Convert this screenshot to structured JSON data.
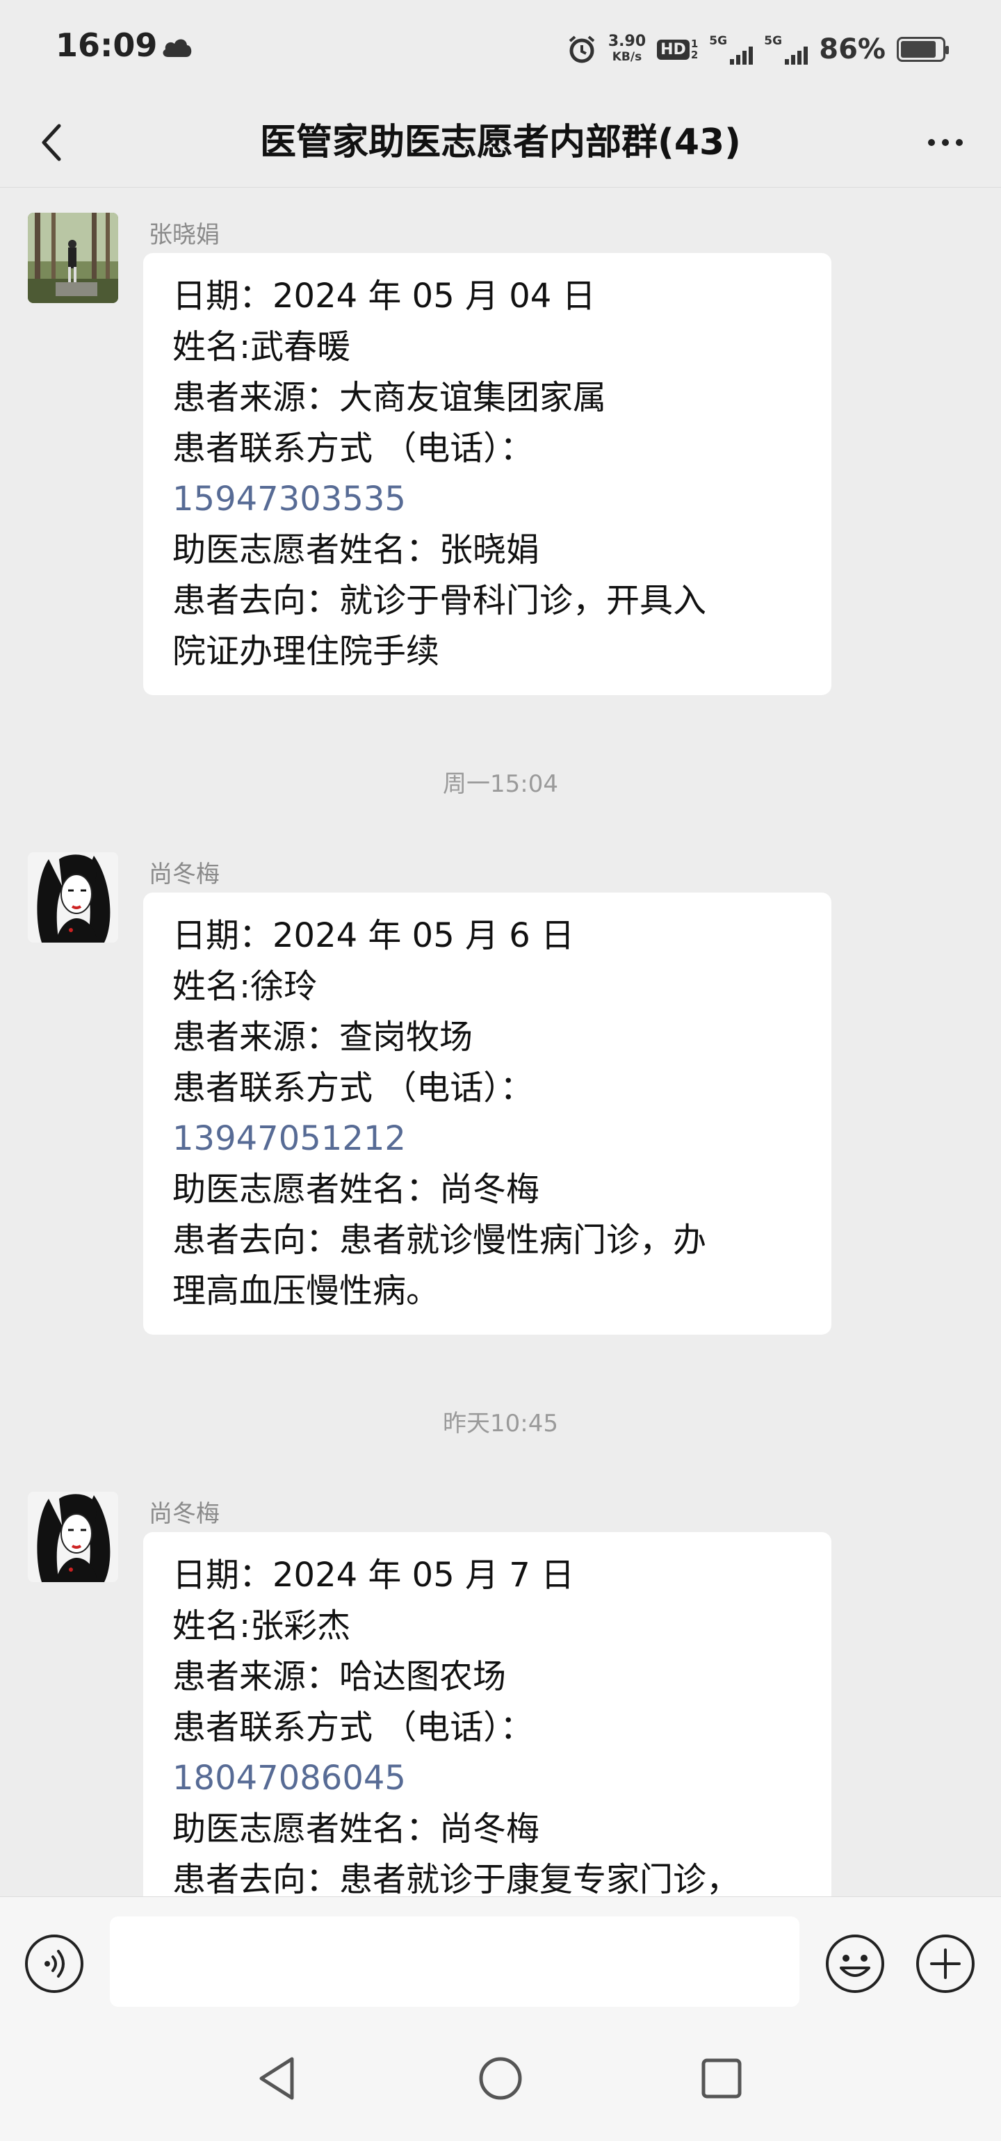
{
  "status_bar": {
    "time": "16:09",
    "net_speed_value": "3.90",
    "net_speed_unit": "KB/s",
    "hd_label": "HD",
    "hd_sub_top": "1",
    "hd_sub_bottom": "2",
    "signal1_label": "5G",
    "signal2_label": "5G",
    "battery_percent": "86%",
    "battery_level": 0.86
  },
  "header": {
    "title": "医管家助医志愿者内部群(43)"
  },
  "messages": [
    {
      "sender": "张晓娟",
      "lines": [
        "日期：2024 年 05 月 04 日",
        "姓名:武春暖",
        "患者来源：大商友谊集团家属",
        "患者联系方式 （电话）："
      ],
      "phone": "15947303535",
      "lines_after": [
        "助医志愿者姓名：张晓娟",
        "患者去向：就诊于骨科门诊，开具入",
        "院证办理住院手续"
      ]
    },
    {
      "timestamp": "周一15:04",
      "sender": "尚冬梅",
      "lines": [
        "日期：2024 年 05 月 6 日",
        "姓名:徐玲",
        "患者来源：查岗牧场",
        "患者联系方式 （电话）："
      ],
      "phone": "13947051212",
      "lines_after": [
        "助医志愿者姓名：尚冬梅",
        "患者去向：患者就诊慢性病门诊，办",
        "理高血压慢性病。"
      ]
    },
    {
      "timestamp": "昨天10:45",
      "sender": "尚冬梅",
      "lines": [
        "日期：2024 年 05 月 7 日",
        "姓名:张彩杰",
        "患者来源：哈达图农场",
        "患者联系方式 （电话）："
      ],
      "phone": "18047086045",
      "lines_after": [
        "助医志愿者姓名：尚冬梅",
        "患者去向：患者就诊于康复专家门诊，"
      ]
    }
  ],
  "input": {
    "value": ""
  },
  "icons": {
    "back": "chevron-left-icon",
    "more": "more-dots-icon",
    "voice": "voice-icon",
    "emoji": "emoji-icon",
    "plus": "plus-icon"
  },
  "colors": {
    "background": "#ededed",
    "bubble": "#ffffff",
    "link": "#576b95",
    "timestamp": "#9a9a9a"
  }
}
